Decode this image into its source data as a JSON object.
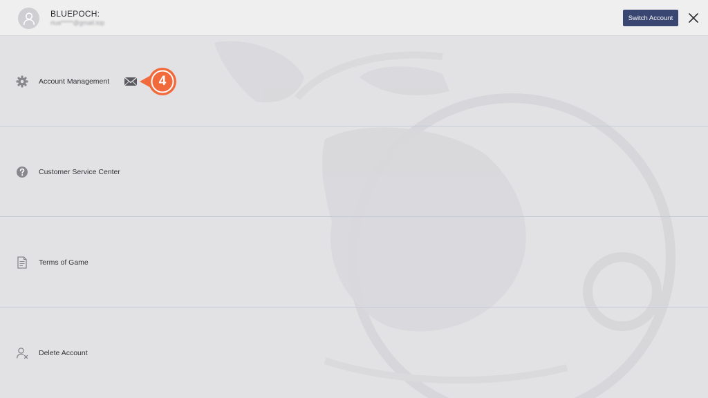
{
  "header": {
    "brand": "BLUEPOCH:",
    "email": "riua*****@gmail.top",
    "switch_account_label": "Switch Account"
  },
  "menu": {
    "items": [
      {
        "label": "Account Management",
        "icon": "gear-icon"
      },
      {
        "label": "Customer Service Center",
        "icon": "question-circle-icon"
      },
      {
        "label": "Terms of Game",
        "icon": "document-icon"
      },
      {
        "label": "Delete Account",
        "icon": "user-delete-icon"
      }
    ]
  },
  "annotation": {
    "step": "4"
  },
  "colors": {
    "accent_button": "#3a4672",
    "step_badge": "#f06a3b",
    "background": "#e2e1e3",
    "header": "#f0efef"
  }
}
